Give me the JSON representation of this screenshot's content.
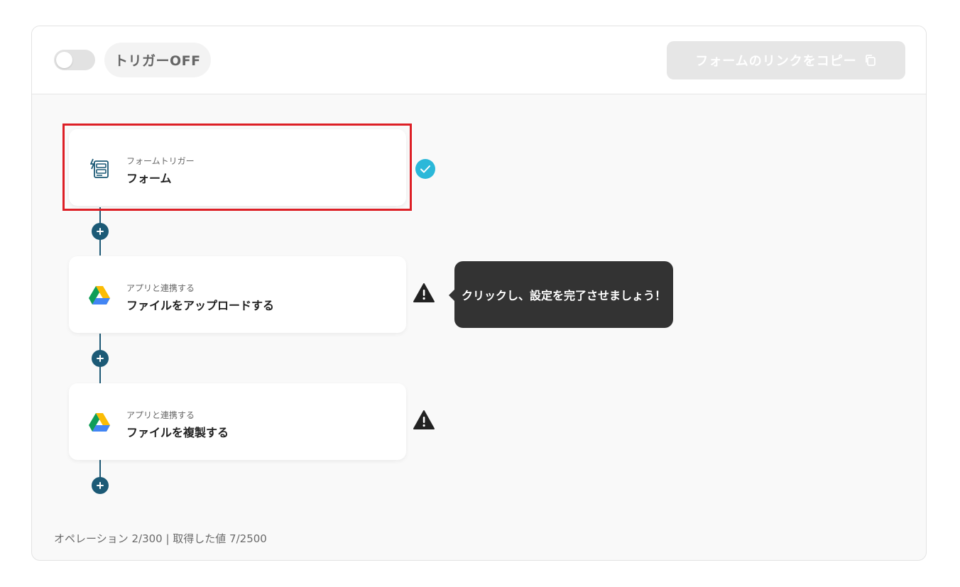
{
  "header": {
    "trigger_toggle_state": "off",
    "trigger_label": "トリガーOFF",
    "copy_link_label": "フォームのリンクをコピー"
  },
  "flow": {
    "steps": [
      {
        "sub": "フォームトリガー",
        "title": "フォーム",
        "icon": "form-trigger-icon",
        "status": "complete",
        "selected": true
      },
      {
        "sub": "アプリと連携する",
        "title": "ファイルをアップロードする",
        "icon": "google-drive-icon",
        "status": "warning"
      },
      {
        "sub": "アプリと連携する",
        "title": "ファイルを複製する",
        "icon": "google-drive-icon",
        "status": "warning"
      }
    ],
    "tooltip": "クリックし、設定を完了させましょう！"
  },
  "footer": {
    "usage": "オペレーション 2/300 | 取得した値 7/2500"
  },
  "colors": {
    "accent": "#1c5a76",
    "check": "#2bb8d9",
    "highlight": "#dd1f26",
    "tooltip_bg": "#333333"
  }
}
